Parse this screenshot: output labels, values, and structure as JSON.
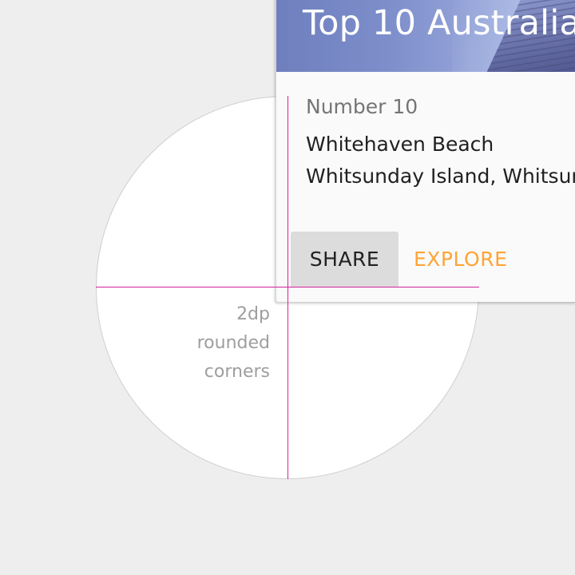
{
  "card": {
    "title": "Top 10 Australia",
    "overline": "Number 10",
    "line1": "Whitehaven Beach",
    "line2": "Whitsunday Island, Whitsunday Islands",
    "actions": {
      "share_label": "SHARE",
      "explore_label": "EXPLORE"
    }
  },
  "annotation": {
    "lines": [
      "2dp",
      "rounded",
      "corners"
    ]
  },
  "colors": {
    "background": "#eeeeee",
    "guide": "#d5239c",
    "accent": "#ffa436",
    "annotation_text": "#9e9e9e"
  }
}
